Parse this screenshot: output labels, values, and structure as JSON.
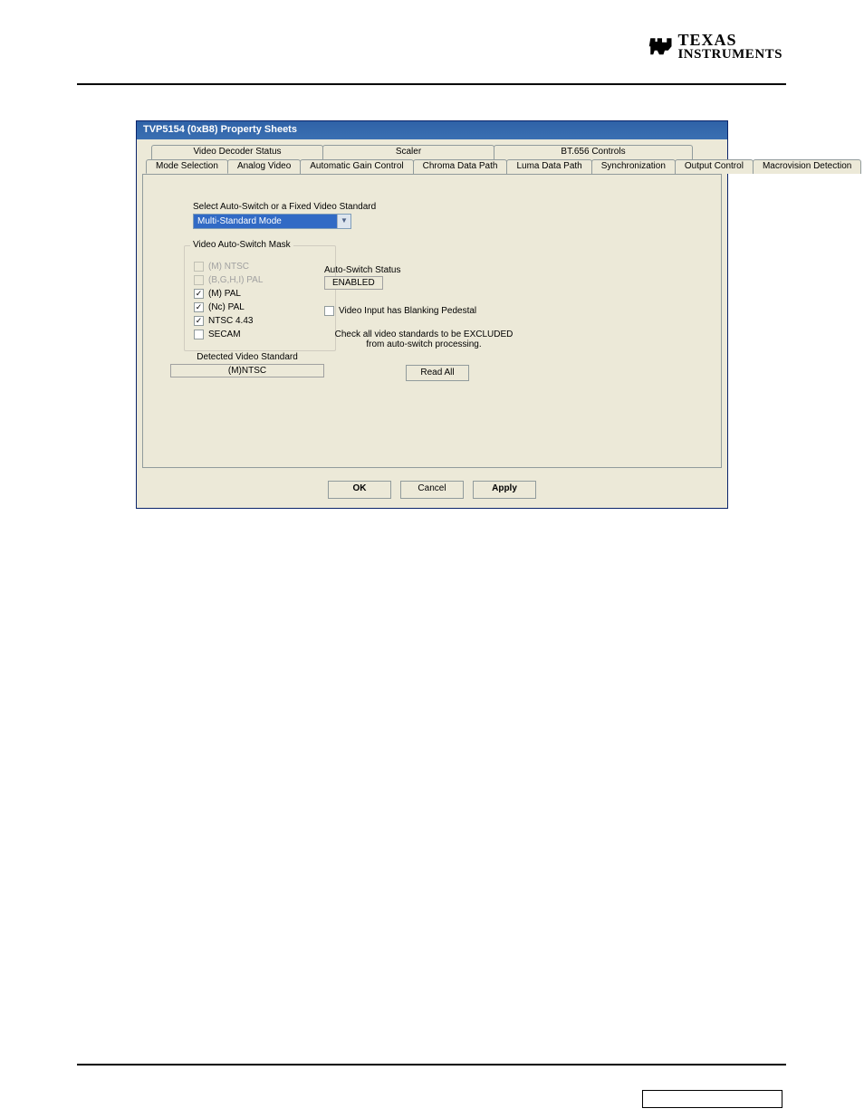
{
  "logo": {
    "line1": "TEXAS",
    "line2": "INSTRUMENTS"
  },
  "dialog": {
    "title": "TVP5154 (0xB8) Property Sheets",
    "tabs_back": [
      "Video Decoder Status",
      "Scaler",
      "BT.656 Controls"
    ],
    "tabs_front": [
      "Mode Selection",
      "Analog Video",
      "Automatic Gain Control",
      "Chroma Data Path",
      "Luma Data Path",
      "Synchronization",
      "Output Control",
      "Macrovision Detection"
    ],
    "select_label": "Select Auto-Switch or a Fixed Video Standard",
    "select_value": "Multi-Standard Mode",
    "mask_group_title": "Video Auto-Switch Mask",
    "mask_items": [
      {
        "label": "(M) NTSC",
        "checked": false,
        "enabled": false
      },
      {
        "label": "(B,G,H,I) PAL",
        "checked": false,
        "enabled": false
      },
      {
        "label": "(M) PAL",
        "checked": true,
        "enabled": true
      },
      {
        "label": "(Nc) PAL",
        "checked": true,
        "enabled": true
      },
      {
        "label": "NTSC 4.43",
        "checked": true,
        "enabled": true
      },
      {
        "label": "SECAM",
        "checked": false,
        "enabled": true
      }
    ],
    "autoswitch_label": "Auto-Switch Status",
    "autoswitch_value": "ENABLED",
    "pedestal_label": "Video Input has Blanking Pedestal",
    "note_line1": "Check all video standards to be EXCLUDED",
    "note_line2": "from auto-switch processing.",
    "detected_label": "Detected Video Standard",
    "detected_value": "(M)NTSC",
    "btn_read_all": "Read All",
    "btn_ok": "OK",
    "btn_cancel": "Cancel",
    "btn_apply": "Apply"
  }
}
